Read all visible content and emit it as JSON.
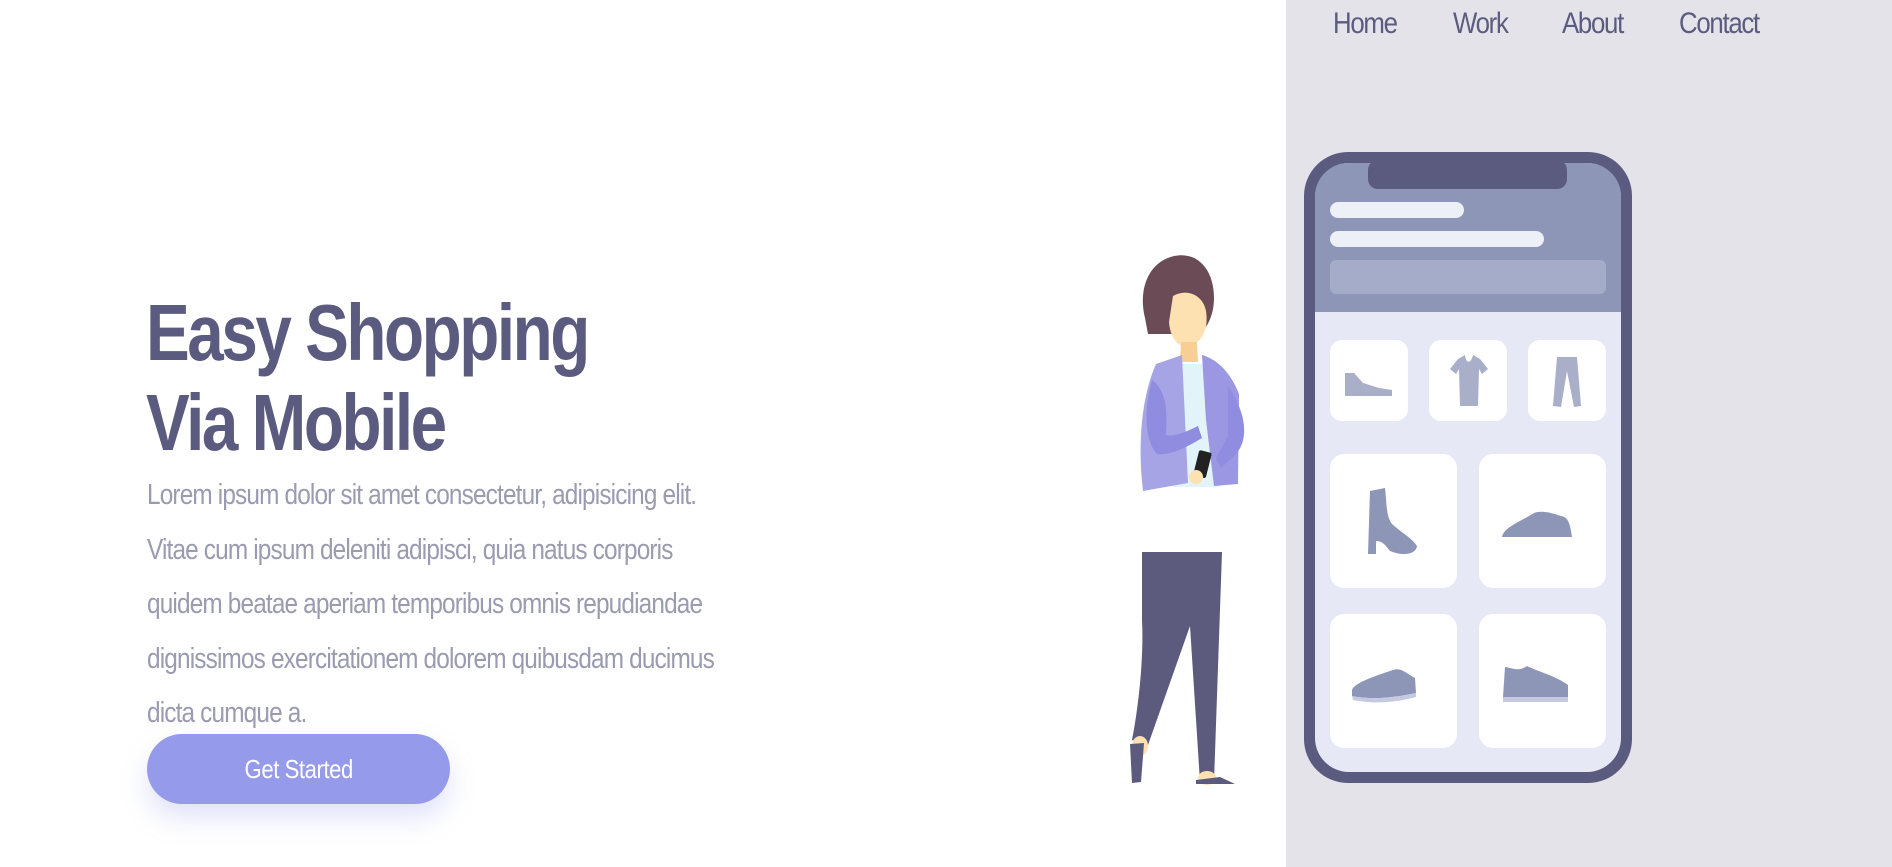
{
  "nav": {
    "items": [
      "Home",
      "Work",
      "About",
      "Contact"
    ]
  },
  "hero": {
    "title_line1": "Easy Shopping",
    "title_line2": "Via Mobile",
    "description": "Lorem ipsum dolor sit amet consectetur, adipisicing elit. Vitae cum ipsum deleniti adipisci, quia natus corporis quidem beatae aperiam temporibus omnis repudiandae dignissimos exercitationem dolorem quibusdam ducimus dicta cumque a.",
    "cta_label": "Get Started"
  },
  "colors": {
    "primary_text": "#5b5b80",
    "body_text": "#9a9ab0",
    "accent": "#959aea",
    "panel_background": "#e4e3ea",
    "phone_frame": "#5b5b80"
  },
  "illustration": {
    "subject": "woman-with-phone-and-large-shopping-app-phone",
    "products": [
      "shoe-icon",
      "tshirt-icon",
      "pants-icon",
      "boot-icon",
      "sneaker-icon",
      "sneaker-icon",
      "sneaker-icon"
    ]
  }
}
